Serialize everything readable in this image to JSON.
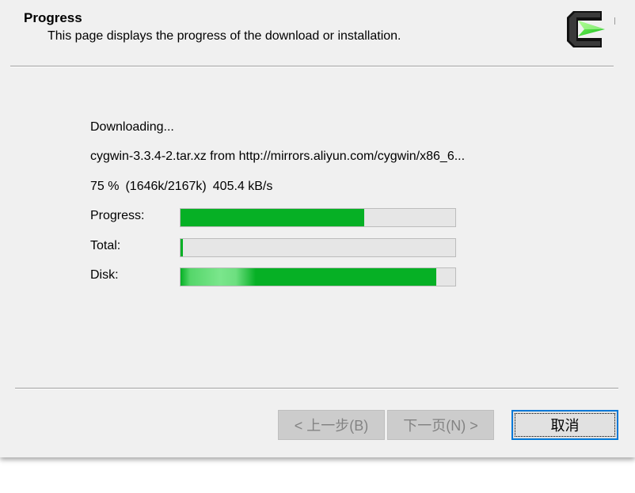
{
  "header": {
    "title": "Progress",
    "subtitle": "This page displays the progress of the download or installation.",
    "logo_icon": "cygwin-logo-icon"
  },
  "status": {
    "action": "Downloading...",
    "file": "cygwin-3.3.4-2.tar.xz from http://mirrors.aliyun.com/cygwin/x86_6...",
    "percent": "75 %",
    "sizes": "(1646k/2167k)",
    "speed": "405.4 kB/s"
  },
  "bars": {
    "progress": {
      "label": "Progress:",
      "fraction": 0.67
    },
    "total": {
      "label": "Total:",
      "fraction": 0.01
    },
    "disk": {
      "label": "Disk:",
      "fraction": 0.93
    }
  },
  "buttons": {
    "back": "< 上一步(B)",
    "next": "下一页(N) >",
    "cancel": "取消"
  },
  "colors": {
    "bar_fill": "#06b025",
    "focus_border": "#0078d7",
    "window_background": "#f0f0f0"
  }
}
